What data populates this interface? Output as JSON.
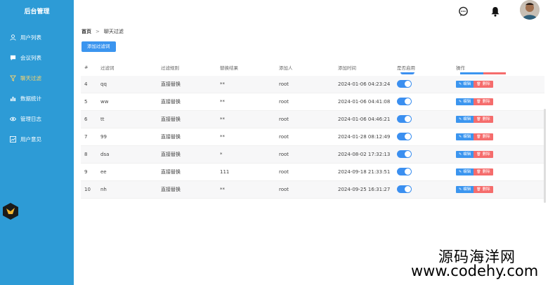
{
  "sidebar": {
    "title": "后台管理",
    "items": [
      {
        "label": "用户列表",
        "icon": "user-icon"
      },
      {
        "label": "会议列表",
        "icon": "chat-icon"
      },
      {
        "label": "聊天过滤",
        "icon": "filter-icon",
        "active": true
      },
      {
        "label": "数据统计",
        "icon": "bar-chart-icon"
      },
      {
        "label": "管理日志",
        "icon": "eye-icon"
      },
      {
        "label": "用户意见",
        "icon": "trend-chart-icon"
      }
    ]
  },
  "breadcrumb": {
    "home": "首页",
    "separator": ">",
    "current": "聊天过滤"
  },
  "toolbar": {
    "add_label": "添加过滤词"
  },
  "table": {
    "headers": [
      "#",
      "过滤词",
      "过滤规则",
      "替换结果",
      "添加人",
      "添加时间",
      "是否启用",
      "操作"
    ],
    "rows": [
      {
        "id": "4",
        "word": "qq",
        "rule": "直接替换",
        "replace": "**",
        "user": "root",
        "time": "2024-01-06 04:23:24",
        "enabled": true
      },
      {
        "id": "5",
        "word": "ww",
        "rule": "直接替换",
        "replace": "**",
        "user": "root",
        "time": "2024-01-06 04:41:08",
        "enabled": true
      },
      {
        "id": "6",
        "word": "tt",
        "rule": "直接替换",
        "replace": "**",
        "user": "root",
        "time": "2024-01-06 04:46:21",
        "enabled": true
      },
      {
        "id": "7",
        "word": "99",
        "rule": "直接替换",
        "replace": "**",
        "user": "root",
        "time": "2024-01-28 08:12:49",
        "enabled": true
      },
      {
        "id": "8",
        "word": "dsa",
        "rule": "直接替换",
        "replace": "*",
        "user": "root",
        "time": "2024-08-02 17:32:13",
        "enabled": true
      },
      {
        "id": "9",
        "word": "ee",
        "rule": "直接替换",
        "replace": "111",
        "user": "root",
        "time": "2024-09-18 21:33:51",
        "enabled": true
      },
      {
        "id": "10",
        "word": "nh",
        "rule": "直接替换",
        "replace": "**",
        "user": "root",
        "time": "2024-09-25 16:31:27",
        "enabled": true
      }
    ],
    "edit_label": "编辑",
    "delete_label": "删除"
  },
  "watermark": {
    "line1": "源码海洋网",
    "line2": "www.codehy.com"
  },
  "colors": {
    "sidebar": "#2d9bd6",
    "primary": "#3b95ef",
    "danger": "#f56c6c",
    "active_nav": "#ffd66b"
  }
}
